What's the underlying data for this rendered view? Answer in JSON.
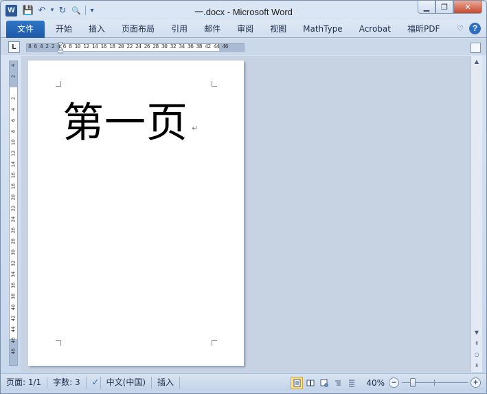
{
  "window": {
    "title": "一.docx - Microsoft Word",
    "app_icon_letter": "W",
    "minimize": "▁",
    "restore": "❐",
    "close": "✕"
  },
  "qat": {
    "save_icon": "💾",
    "undo_icon": "↶",
    "undo_dropdown": "▾",
    "redo_icon": "↻",
    "print_preview_icon": "🔍",
    "customize": "▾"
  },
  "ribbon": {
    "file_tab": "文件",
    "tabs": [
      "开始",
      "插入",
      "页面布局",
      "引用",
      "邮件",
      "审阅",
      "视图",
      "MathType",
      "Acrobat",
      "福昕PDF"
    ],
    "minimize_ribbon": "♡",
    "help": "?"
  },
  "ruler": {
    "toggle_label": "L",
    "horizontal_text": "8 6 4 2   2 4 6 8 10 12 14 16 18 20 22 24 26 28 30 32 34 36 38   42 44 46",
    "vertical_ticks": [
      "4",
      "2",
      "",
      "2",
      "4",
      "6",
      "8",
      "10",
      "12",
      "14",
      "16",
      "18",
      "20",
      "22",
      "24",
      "26",
      "28",
      "30",
      "32",
      "34",
      "36",
      "38",
      "40",
      "42",
      "44",
      "46",
      "48"
    ]
  },
  "document": {
    "text": "第一页",
    "paragraph_mark": "↵"
  },
  "scrollbar": {
    "up": "▲",
    "down": "▼",
    "prev_page": "⇞",
    "browse_object": "○",
    "next_page": "⇟"
  },
  "status": {
    "page": "页面: 1/1",
    "words": "字数: 3",
    "proofing_icon": "✓",
    "language": "中文(中国)",
    "mode": "插入",
    "zoom": "40%",
    "zoom_out": "−",
    "zoom_in": "+",
    "zoom_level": 0.4
  },
  "colors": {
    "accent": "#2b5797",
    "file_tab": "#1d59a8",
    "active_view": "#fbdf8f"
  }
}
